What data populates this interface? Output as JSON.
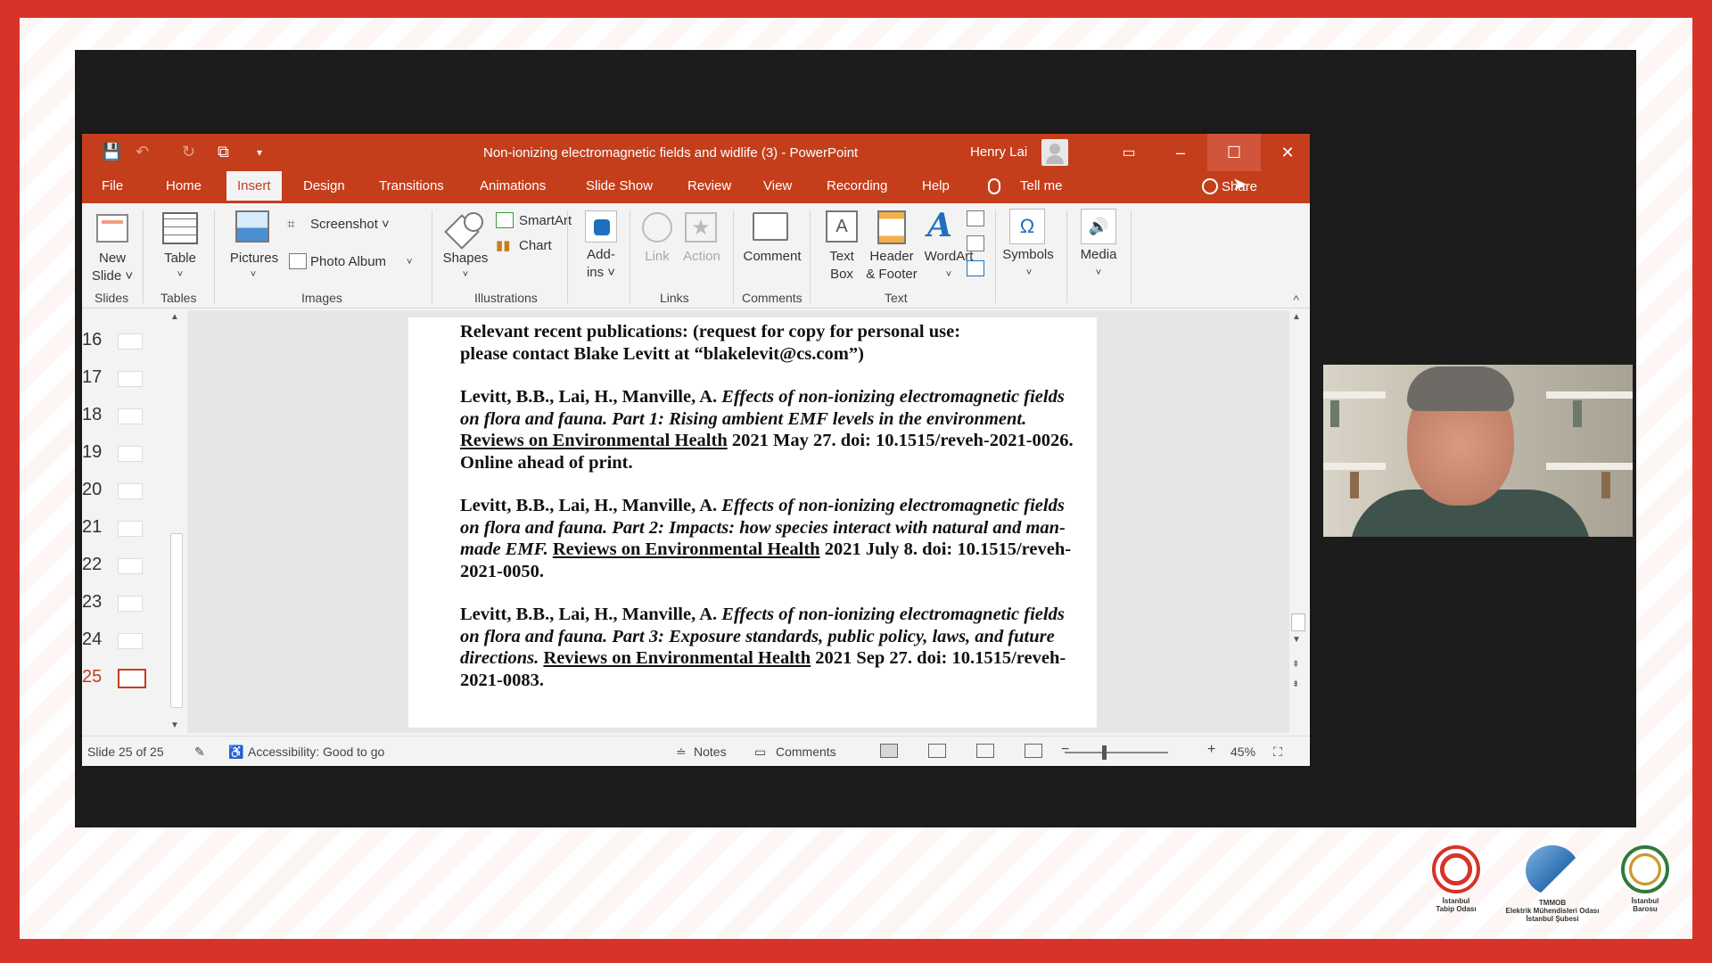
{
  "window": {
    "title": "Non-ionizing electromagnetic fields and widlife (3) - PowerPoint",
    "user": "Henry Lai"
  },
  "tabs": [
    "File",
    "Home",
    "Insert",
    "Design",
    "Transitions",
    "Animations",
    "Slide Show",
    "Review",
    "View",
    "Recording",
    "Help"
  ],
  "active_tab": "Insert",
  "tell_me": "Tell me",
  "share": "Share",
  "ribbon": {
    "slides": {
      "new_slide_1": "New",
      "new_slide_2": "Slide ˅",
      "group": "Slides"
    },
    "tables": {
      "table": "Table",
      "group": "Tables"
    },
    "images": {
      "pictures": "Pictures",
      "screenshot": "Screenshot ˅",
      "photo_album": "Photo Album",
      "group": "Images"
    },
    "illustrations": {
      "shapes": "Shapes",
      "smartart": "SmartArt",
      "chart": "Chart",
      "group": "Illustrations"
    },
    "addins": {
      "addins_1": "Add-",
      "addins_2": "ins ˅"
    },
    "links": {
      "link": "Link",
      "action": "Action",
      "group": "Links"
    },
    "comments": {
      "comment": "Comment",
      "group": "Comments"
    },
    "text": {
      "textbox_1": "Text",
      "textbox_2": "Box",
      "hf_1": "Header",
      "hf_2": "& Footer",
      "wordart": "WordArt",
      "group": "Text"
    },
    "symbols": {
      "symbols": "Symbols"
    },
    "media": {
      "media": "Media"
    }
  },
  "thumbnails": [
    "16",
    "17",
    "18",
    "19",
    "20",
    "21",
    "22",
    "23",
    "24",
    "25"
  ],
  "active_slide": "25",
  "slide": {
    "intro_1": "Relevant recent publications: (request for copy for personal use:",
    "intro_2": "please contact Blake Levitt at “blakelevit@cs.com”)",
    "refs": [
      {
        "authors": "Levitt, B.B., Lai, H., Manville, A. ",
        "title": "Effects of non-ionizing electromagnetic fields on flora and fauna. Part 1: Rising ambient EMF levels in the environment.",
        "journal": "Reviews on Environmental Health",
        "rest": "2021 May 27. doi: 10.1515/reveh-2021-0026. Online ahead of print."
      },
      {
        "authors": "Levitt, B.B., Lai, H., Manville, A. ",
        "title": "Effects of non-ionizing electromagnetic fields on flora and fauna. Part 2: Impacts: how species interact with natural and man-made EMF.",
        "journal": "Reviews on Environmental Health",
        "rest": " 2021 July 8. doi: 10.1515/reveh-2021-0050."
      },
      {
        "authors": "Levitt, B.B., Lai, H., Manville, A. ",
        "title": "Effects of non-ionizing electromagnetic fields on flora and fauna. Part 3: Exposure standards, public policy, laws, and future directions.",
        "journal": "Reviews on Environmental Health",
        "rest": "  2021 Sep 27.  doi: 10.1515/reveh-2021-0083."
      }
    ]
  },
  "status": {
    "slide_count": "Slide 25 of 25",
    "accessibility": "Accessibility: Good to go",
    "notes": "Notes",
    "comments": "Comments",
    "zoom": "45%"
  },
  "logos": [
    {
      "line1": "İstanbul",
      "line2": "Tabip Odası",
      "line3": "",
      "color": "#d8332a"
    },
    {
      "line1": "TMMOB",
      "line2": "Elektrik Mühendisleri Odası",
      "line3": "İstanbul Şubesi",
      "color": "#3a7fc1"
    },
    {
      "line1": "İstanbul",
      "line2": "Barosu",
      "line3": "",
      "color": "#2f7a3a"
    }
  ]
}
